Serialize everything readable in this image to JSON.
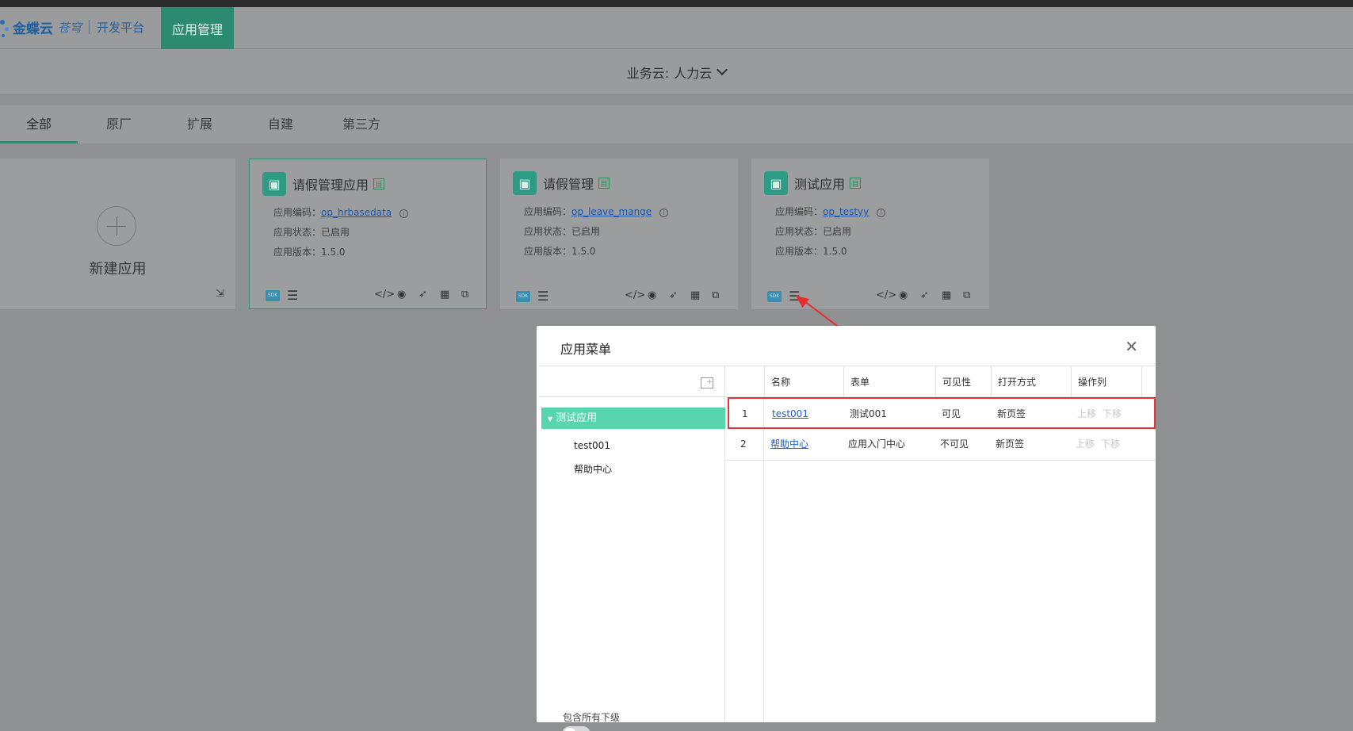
{
  "header": {
    "brand": "金蝶云",
    "brand_sub": "苍穹",
    "platform": "开发平台",
    "nav_active": "应用管理"
  },
  "biz_cloud": {
    "label": "业务云:",
    "value": "人力云"
  },
  "tabs": [
    {
      "label": "全部"
    },
    {
      "label": "原厂"
    },
    {
      "label": "扩展"
    },
    {
      "label": "自建"
    },
    {
      "label": "第三方"
    }
  ],
  "new_app": {
    "label": "新建应用"
  },
  "cards": [
    {
      "title": "请假管理应用",
      "code_label": "应用编码：",
      "code": "op_hrbasedata",
      "status_label": "应用状态：",
      "status": "已启用",
      "version_label": "应用版本：",
      "version": "1.5.0"
    },
    {
      "title": "请假管理",
      "code_label": "应用编码：",
      "code": "op_leave_mange",
      "status_label": "应用状态：",
      "status": "已启用",
      "version_label": "应用版本：",
      "version": "1.5.0"
    },
    {
      "title": "测试应用",
      "code_label": "应用编码：",
      "code": "op_testyy",
      "status_label": "应用状态：",
      "status": "已启用",
      "version_label": "应用版本：",
      "version": "1.5.0"
    }
  ],
  "modal": {
    "title": "应用菜单",
    "tree_root": "测试应用",
    "tree_children": [
      "test001",
      "帮助中心"
    ],
    "toggle_label": "包含所有下级",
    "columns": [
      "名称",
      "表单",
      "可见性",
      "打开方式",
      "操作列"
    ],
    "rows": [
      {
        "index": "1",
        "name": "test001",
        "form": "测试001",
        "visibility": "可见",
        "open_mode": "新页签",
        "up": "上移",
        "down": "下移"
      },
      {
        "index": "2",
        "name": "帮助中心",
        "form": "应用入门中心",
        "visibility": "不可见",
        "open_mode": "新页签",
        "up": "上移",
        "down": "下移"
      }
    ]
  },
  "colors": {
    "accent": "#2b8a6f",
    "tree_active": "#58d5ad",
    "highlight": "#e2333a"
  }
}
